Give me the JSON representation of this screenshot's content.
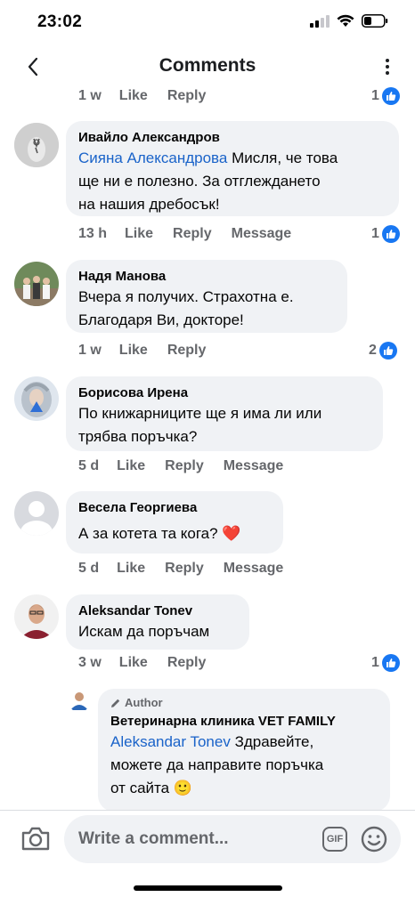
{
  "status_bar": {
    "time": "23:02"
  },
  "header": {
    "title": "Comments"
  },
  "top_partial": {
    "time": "1 w",
    "like": "Like",
    "reply": "Reply",
    "reaction_count": "1"
  },
  "comments": [
    {
      "author": "Ивайло Александров",
      "mention": "Сияна Александрова",
      "text_lines": [
        " Мисля, че това",
        "ще ни е полезно. За отглеждането",
        "на нашия дребосък!"
      ],
      "time": "13 h",
      "like": "Like",
      "reply": "Reply",
      "message": "Message",
      "reaction_count": "1"
    },
    {
      "author": "Надя Манова",
      "text_lines": [
        "Вчера я получих. Страхотна е.",
        "Благодаря Ви, докторе!"
      ],
      "time": "1 w",
      "like": "Like",
      "reply": "Reply",
      "reaction_count": "2"
    },
    {
      "author": "Борисова Ирена",
      "text_lines": [
        "По книжарниците ще я има ли или",
        "трябва поръчка?"
      ],
      "time": "5 d",
      "like": "Like",
      "reply": "Reply",
      "message": "Message"
    },
    {
      "author": "Весела Георгиева",
      "text": "А за котета та кога? ❤️",
      "time": "5 d",
      "like": "Like",
      "reply": "Reply",
      "message": "Message"
    },
    {
      "author": "Aleksandar Tonev",
      "text": "Искам да поръчам",
      "time": "3 w",
      "like": "Like",
      "reply": "Reply",
      "reaction_count": "1"
    }
  ],
  "reply": {
    "author_tag": "Author",
    "author": "Ветеринарна клиника VET FAMILY",
    "mention": "Aleksandar Tonev",
    "text_lines": [
      " Здравейте,",
      "можете да направите поръчка",
      "от сайта 🙂"
    ]
  },
  "composer": {
    "placeholder": "Write a comment...",
    "gif_label": "GIF"
  },
  "colors": {
    "accent": "#1877f2",
    "mention": "#1a63c9",
    "bubble": "#f0f2f5",
    "meta": "#65676b"
  }
}
